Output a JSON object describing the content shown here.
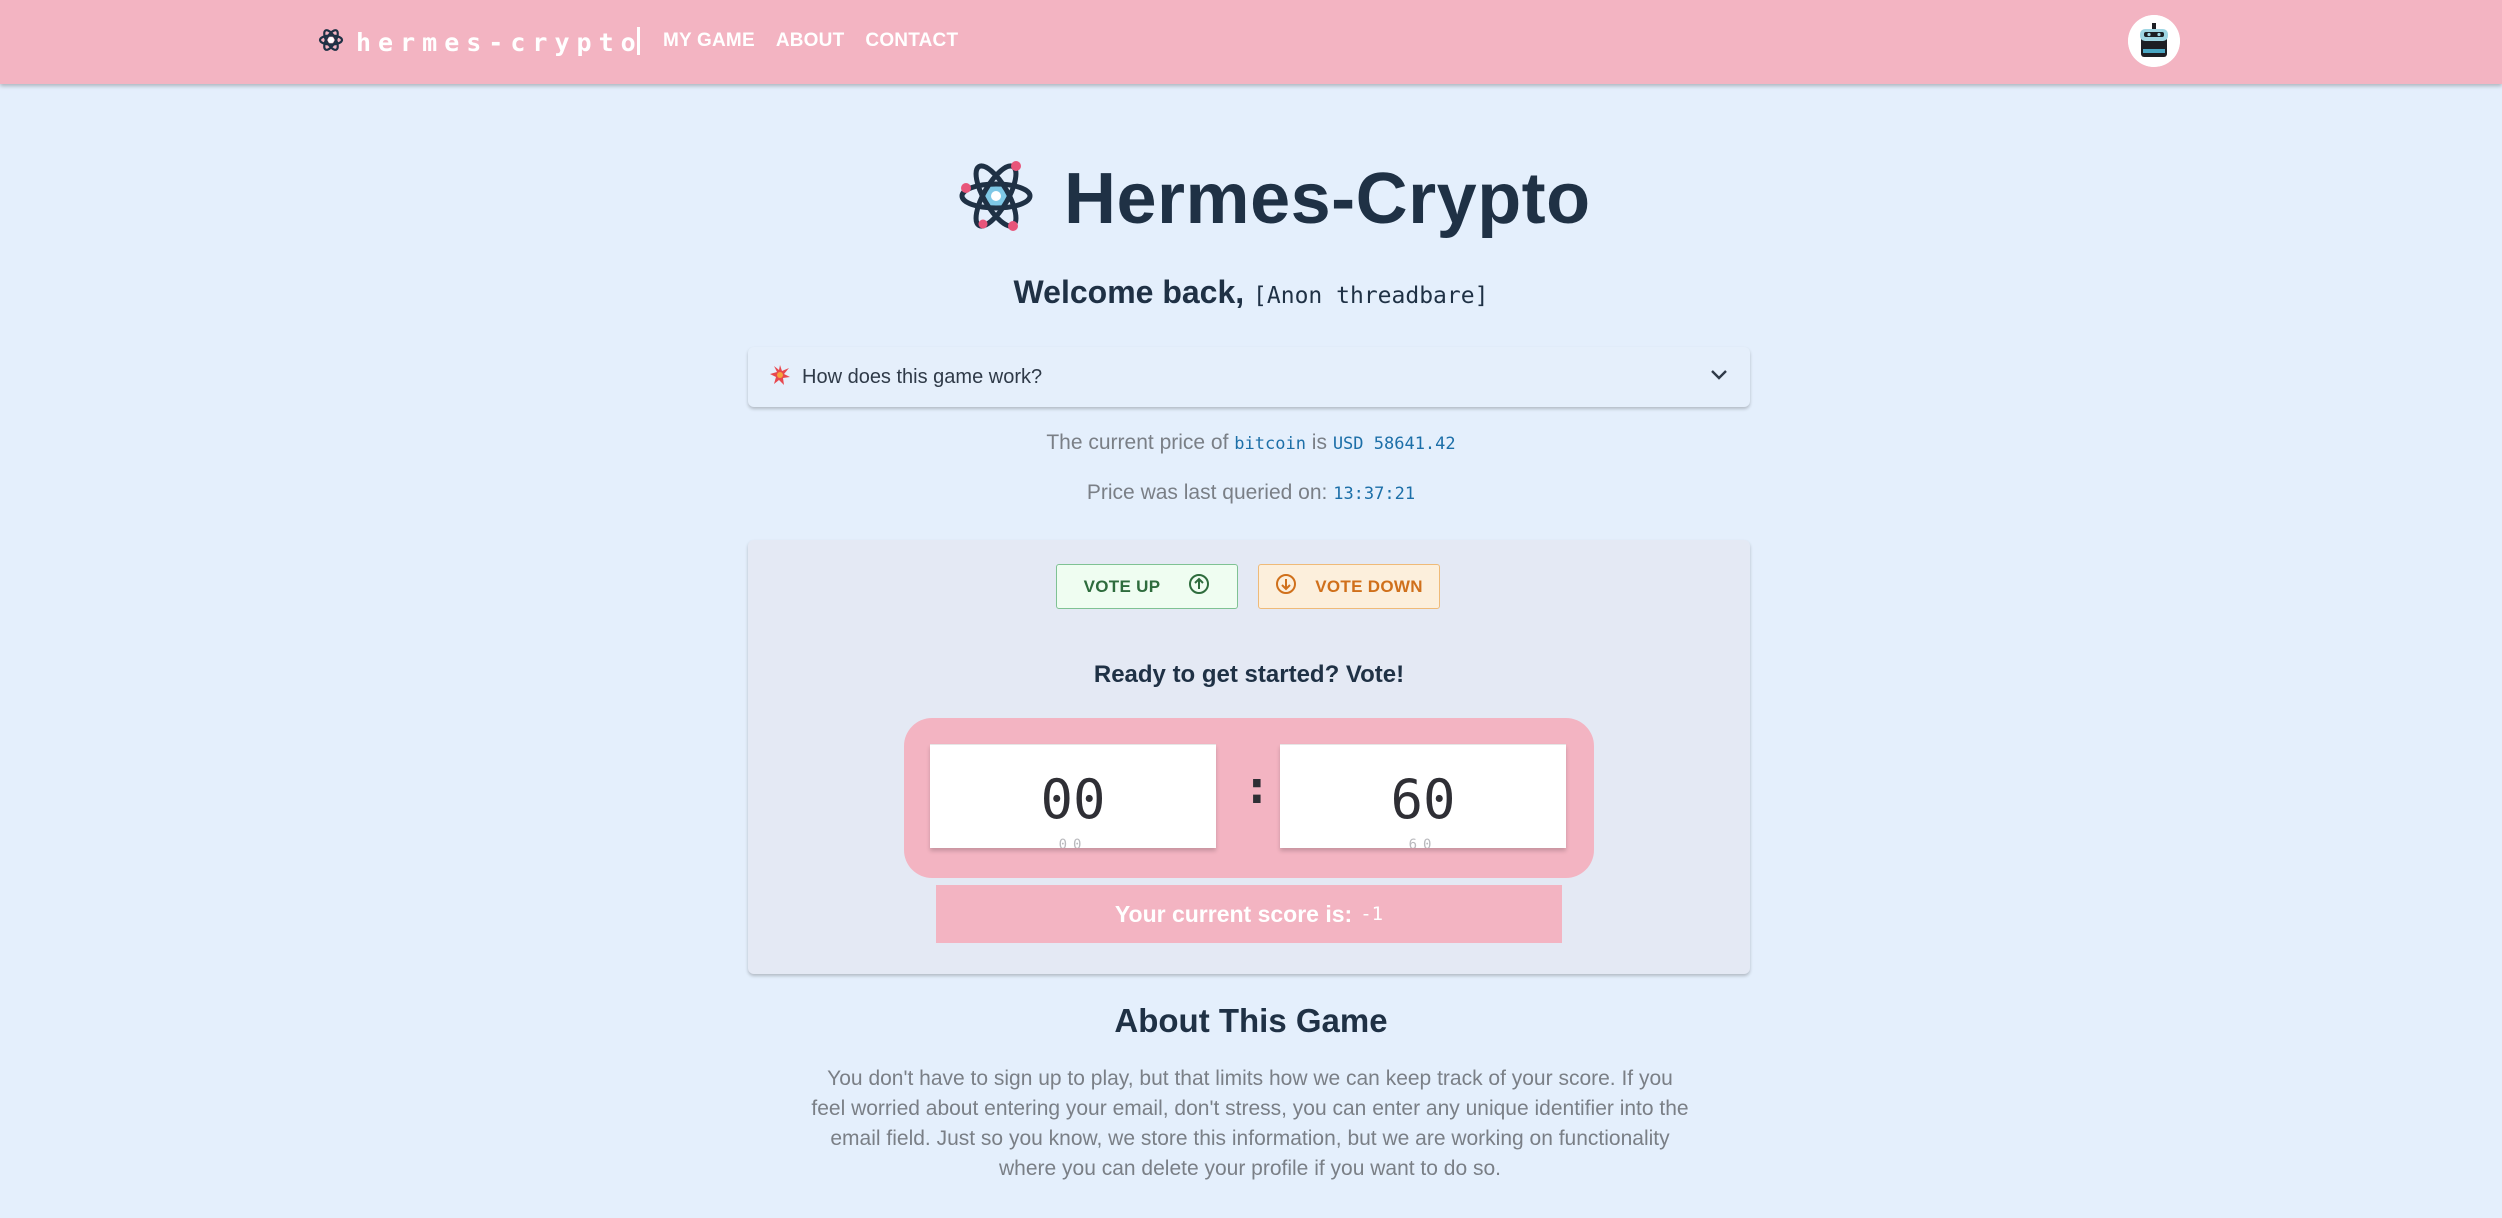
{
  "nav": {
    "brand": "hermes-crypto",
    "links": [
      "MY GAME",
      "ABOUT",
      "CONTACT"
    ]
  },
  "hero": {
    "title": "Hermes-Crypto",
    "welcome_prefix": "Welcome back,",
    "username": "[Anon threadbare]"
  },
  "accordion": {
    "label": "How does this game work?"
  },
  "price": {
    "prefix": "The current price of",
    "coin": "bitcoin",
    "is": "is",
    "value": "USD 58641.42",
    "query_label": "Price was last queried on:",
    "query_time": "13:37:21"
  },
  "game": {
    "vote_up": "VOTE UP",
    "vote_down": "VOTE DOWN",
    "ready": "Ready to get started? Vote!",
    "timer_minutes": "00",
    "timer_seconds": "60",
    "timer_separator": ":",
    "score_label": "Your current score is:",
    "score_value": "-1"
  },
  "about": {
    "title": "About This Game",
    "text": "You don't have to sign up to play, but that limits how we can keep track of your score. If you feel worried about entering your email, don't stress, you can enter any unique identifier into the email field. Just so you know, we store this information, but we are working on functionality where you can delete your profile if you want to do so."
  },
  "colors": {
    "nav_bg": "#f3b4c2",
    "page_bg": "#e4effc",
    "vote_up": "#2e6c3d",
    "vote_down": "#d0701b",
    "accent_text": "#1c6fa8"
  },
  "icons": {
    "brand": "atom-logo-icon",
    "avatar": "robot-avatar-icon",
    "accordion": "sparkle-icon",
    "accordion_toggle": "chevron-down-icon",
    "vote_up": "arrow-up-circle-icon",
    "vote_down": "arrow-down-circle-icon"
  }
}
